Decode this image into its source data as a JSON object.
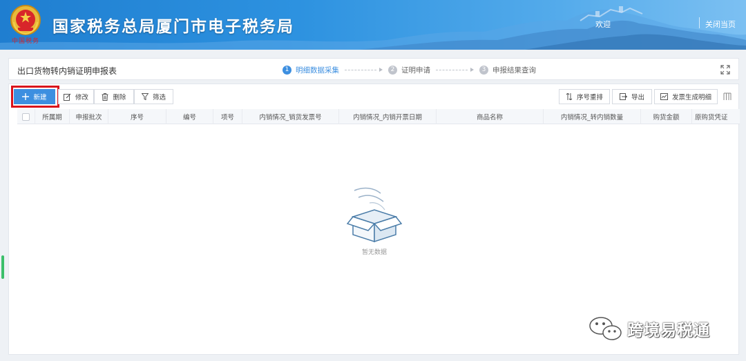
{
  "header": {
    "site_title": "国家税务总局厦门市电子税务局",
    "emblem_caption": "中国税务",
    "welcome": "欢迎",
    "close_page": "关闭当页"
  },
  "title_bar": {
    "page_title": "出口货物转内销证明申报表",
    "steps": [
      {
        "num": "1",
        "label": "明细数据采集",
        "active": true
      },
      {
        "num": "2",
        "label": "证明申请",
        "active": false
      },
      {
        "num": "3",
        "label": "申报结果查询",
        "active": false
      }
    ],
    "fullscreen_icon": "expand-icon"
  },
  "toolbar": {
    "new_label": "新建",
    "edit_label": "修改",
    "delete_label": "删除",
    "filter_label": "筛选",
    "reorder_label": "序号重排",
    "export_label": "导出",
    "generate_label": "发票生成明细",
    "highlight_color": "#d9121b"
  },
  "table": {
    "columns": [
      "所属期",
      "申报批次",
      "序号",
      "编号",
      "项号",
      "内销情况_销货发票号",
      "内销情况_内销开票日期",
      "商品名称",
      "内销情况_转内销数量",
      "购货金额",
      "原购货凭证"
    ],
    "empty_text": "暂无数据"
  },
  "watermark": {
    "text": "跨境易税通"
  },
  "colors": {
    "primary": "#3d8fe0",
    "banner": "#2d92e0"
  }
}
